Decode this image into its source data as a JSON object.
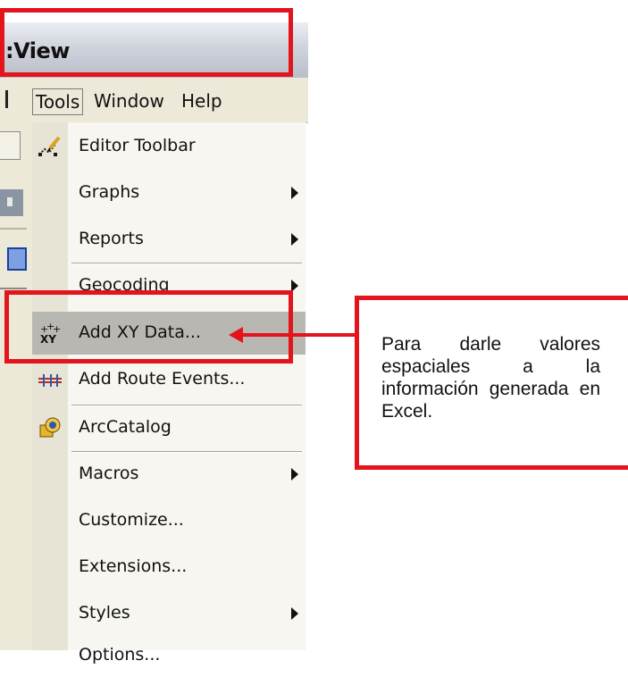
{
  "window": {
    "title_fragment": ":View"
  },
  "menubar": {
    "items": [
      {
        "label": "Tools",
        "active": true
      },
      {
        "label": "Window",
        "active": false
      },
      {
        "label": "Help",
        "active": false
      }
    ]
  },
  "tools_menu": {
    "items": [
      {
        "label": "Editor Toolbar",
        "icon": "editor-toolbar-icon",
        "submenu": false
      },
      {
        "label": "Graphs",
        "icon": null,
        "submenu": true
      },
      {
        "label": "Reports",
        "icon": null,
        "submenu": true
      },
      {
        "label": "Geocoding",
        "icon": null,
        "submenu": true
      },
      {
        "label": "Add XY Data...",
        "icon": "add-xy-data-icon",
        "submenu": false,
        "highlighted": true
      },
      {
        "label": "Add Route Events...",
        "icon": "add-route-events-icon",
        "submenu": false
      },
      {
        "label": "ArcCatalog",
        "icon": "arccatalog-icon",
        "submenu": false
      },
      {
        "label": "Macros",
        "icon": null,
        "submenu": true
      },
      {
        "label": "Customize...",
        "icon": null,
        "submenu": false
      },
      {
        "label": "Extensions...",
        "icon": null,
        "submenu": false
      },
      {
        "label": "Styles",
        "icon": null,
        "submenu": true
      },
      {
        "label": "Options...",
        "icon": null,
        "submenu": false
      }
    ]
  },
  "annotation": {
    "text": "Para darle valores espaciales a la información generada en Excel.",
    "color": "#e3141b"
  }
}
